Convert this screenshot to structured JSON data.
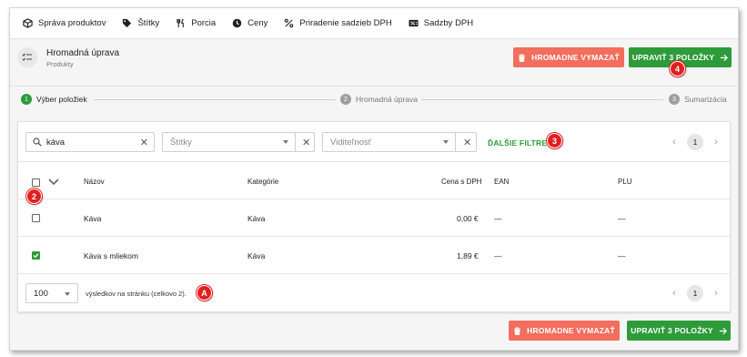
{
  "nav": {
    "items": [
      {
        "label": "Správa produktov",
        "icon": "cube-icon"
      },
      {
        "label": "Štítky",
        "icon": "tag-icon"
      },
      {
        "label": "Porcia",
        "icon": "fork-knife-icon"
      },
      {
        "label": "Ceny",
        "icon": "clock-icon"
      },
      {
        "label": "Priradenie sadzieb DPH",
        "icon": "percent-icon"
      },
      {
        "label": "Sadzby DPH",
        "icon": "percent-card-icon"
      }
    ]
  },
  "header": {
    "title": "Hromadná úprava",
    "subtitle": "Produkty",
    "delete_label": "HROMADNE VYMAZAŤ",
    "edit_label": "UPRAVIŤ 3 POLOŽKY"
  },
  "stepper": {
    "steps": [
      {
        "num": "1",
        "label": "Výber položiek",
        "active": true
      },
      {
        "num": "2",
        "label": "Hromadná úprava",
        "active": false
      },
      {
        "num": "3",
        "label": "Sumarizácia",
        "active": false
      }
    ]
  },
  "filters": {
    "search_value": "káva",
    "tags_placeholder": "Štítky",
    "visibility_placeholder": "Viditeľnosť",
    "more_filters_label": "ĎALŠIE FILTRE"
  },
  "pagination": {
    "current_page": "1",
    "prev": "‹",
    "next": "›"
  },
  "table": {
    "columns": [
      "Názov",
      "Kategórie",
      "Cena s DPH",
      "EAN",
      "PLU"
    ],
    "rows": [
      {
        "checked": false,
        "name": "Káva",
        "category": "Káva",
        "price": "0,00 €",
        "ean": "—",
        "plu": "—"
      },
      {
        "checked": true,
        "name": "Káva s mliekom",
        "category": "Káva",
        "price": "1,89 €",
        "ean": "—",
        "plu": "—"
      }
    ]
  },
  "footer": {
    "per_page": "100",
    "per_page_label": "výsledkov na stránku (celkovo 2)."
  },
  "bottom": {
    "delete_label": "HROMADNE VYMAZAŤ",
    "edit_label": "UPRAVIŤ 3 POLOŽKY"
  },
  "annotations": {
    "one": "4",
    "two": "2",
    "three": "3",
    "four": "A"
  },
  "colors": {
    "accent_green": "#2e9b3a",
    "danger_red": "#f26e5e",
    "annotation_red": "#e02020"
  }
}
